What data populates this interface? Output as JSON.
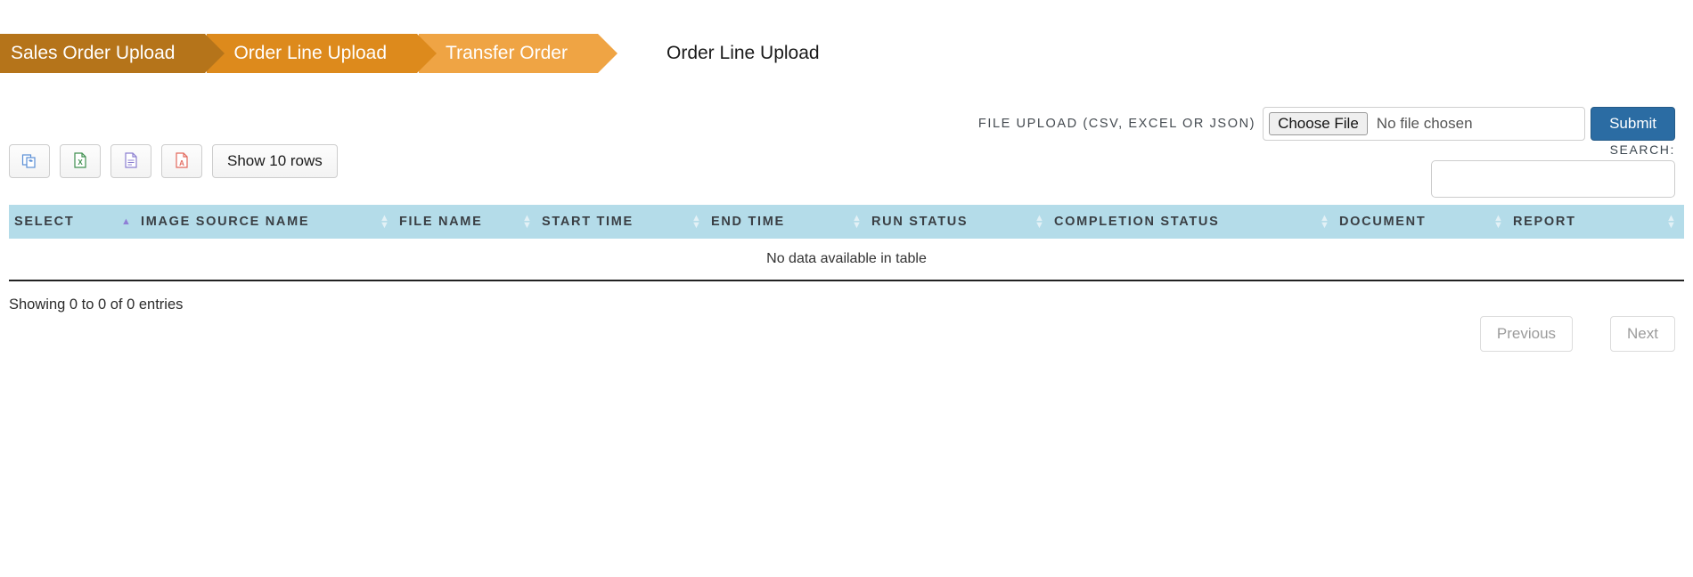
{
  "breadcrumb": {
    "items": [
      {
        "label": "Sales Order Upload",
        "color": "#b5741a"
      },
      {
        "label": "Order Line Upload",
        "color": "#dd8a1c"
      },
      {
        "label": "Transfer Order",
        "color": "#efa444"
      }
    ]
  },
  "page": {
    "title": "Order Line Upload"
  },
  "upload": {
    "label": "File Upload (CSV, Excel or JSON)",
    "choose_button": "Choose File",
    "file_status": "No file chosen",
    "submit_label": "Submit",
    "submit_color": "#2b6ca3"
  },
  "search": {
    "label": "Search:",
    "value": "",
    "placeholder": ""
  },
  "toolbar": {
    "buttons": [
      {
        "name": "copy-icon",
        "title": "Copy"
      },
      {
        "name": "excel-icon",
        "title": "Excel"
      },
      {
        "name": "csv-icon",
        "title": "CSV"
      },
      {
        "name": "pdf-icon",
        "title": "PDF"
      }
    ],
    "rows_label": "Show 10 rows"
  },
  "table": {
    "columns": [
      {
        "label": "Select",
        "sorted": "none",
        "arrow": false
      },
      {
        "label": "Image Source Name",
        "sorted": "asc",
        "arrow": true
      },
      {
        "label": "File Name",
        "sorted": "none",
        "arrow": true
      },
      {
        "label": "Start Time",
        "sorted": "none",
        "arrow": true
      },
      {
        "label": "End Time",
        "sorted": "none",
        "arrow": true
      },
      {
        "label": "Run Status",
        "sorted": "none",
        "arrow": true
      },
      {
        "label": "Completion Status",
        "sorted": "none",
        "arrow": true
      },
      {
        "label": "Document",
        "sorted": "none",
        "arrow": true
      },
      {
        "label": "Report",
        "sorted": "none",
        "arrow": true
      }
    ],
    "rows": [],
    "empty_message": "No data available in table",
    "header_color": "#b4dce9"
  },
  "footer": {
    "info": "Showing 0 to 0 of 0 entries",
    "previous_label": "Previous",
    "next_label": "Next"
  }
}
